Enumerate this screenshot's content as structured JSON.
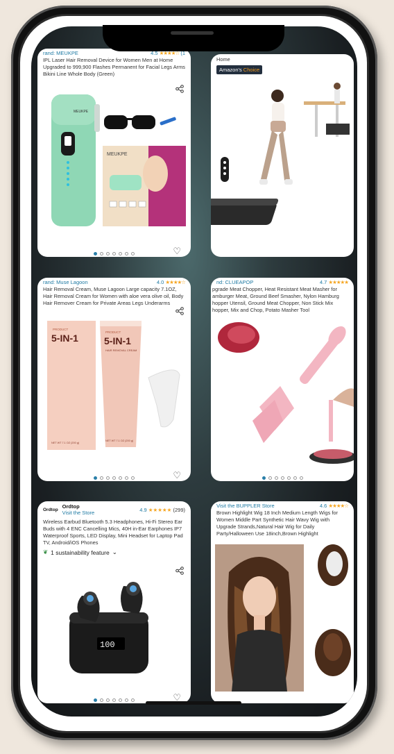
{
  "cards": [
    {
      "brand": "rand: MEUKPE",
      "rating": "4.5",
      "stars": "★★★★☆",
      "count": "(1",
      "title": "IPL Laser Hair Removal Device for Women Men at Home Upgraded to 999,900 Flashes Permanent for Facial Legs Arms Bikini Line Whole Body (Green)",
      "box_brand": "MEUKPE",
      "device_label": "MEUKPE"
    },
    {
      "subtitle": "Home",
      "badge_prefix": "Amazon's",
      "badge_suffix": "Choice"
    },
    {
      "brand": "rand: Muse Lagoon",
      "rating": "4.0",
      "stars": "★★★★☆",
      "title": "Hair Removal Cream, Muse Lagoon Large capacity 7.1OZ, Hair Removal Cream for Women with aloe vera olive oil, Body Hair Remover Cream for Private Areas Legs Underarms",
      "product_label": "5-IN-1",
      "product_top": "PRODUCT",
      "product_sub": "HAIR REMOVAL CREAM",
      "net_wt": "NET WT 7.1 OZ (200 g)"
    },
    {
      "brand": "nd: CLUEAPOP",
      "rating": "4.7",
      "stars": "★★★★★",
      "title": "pgrade Meat Chopper, Heat Resistant Meat Masher for amburger Meat, Ground Beef Smasher, Nylon Hamburg hopper Utensil, Ground Meat Chopper, Non Stick Mix hopper, Mix and Chop, Potato Masher Tool"
    },
    {
      "logo": "Ordtop",
      "store": "Ordtop",
      "visit": "Visit the Store",
      "rating": "4.9",
      "stars": "★★★★★",
      "count": "(299)",
      "title": "Wireless Earbud Bluetooth 5.3 Headphones, Hi-Fi Stereo Ear Buds with 4 ENC Cancelling Mics, 40H in-Ear Earphones IP7 Waterproof Sports, LED Display, Mini Headset for Laptop Pad TV, Android/iOS Phones",
      "sustainability": "1 sustainability feature",
      "display": "100"
    },
    {
      "brand": "Visit the BUPPLER Store",
      "rating": "4.6",
      "stars": "★★★★☆",
      "title": "Brown Highlight Wig 18 Inch Medium Length Wigs for Women Middle Part Synthetic Hair Wavy Wig with Upgrade Strands,Natural Hair Wig for Daily Party/Halloween Use 18inch,Brown Highlight"
    }
  ],
  "colors": {
    "link": "#1f7aa3",
    "star": "#f5a623",
    "device_green": "#8fd7b5",
    "cream_pink": "#f1c7b8",
    "chopper_pink": "#f3b6c2"
  },
  "icons": [
    "share-icon",
    "heart-icon",
    "leaf-icon",
    "chevron-down-icon"
  ]
}
